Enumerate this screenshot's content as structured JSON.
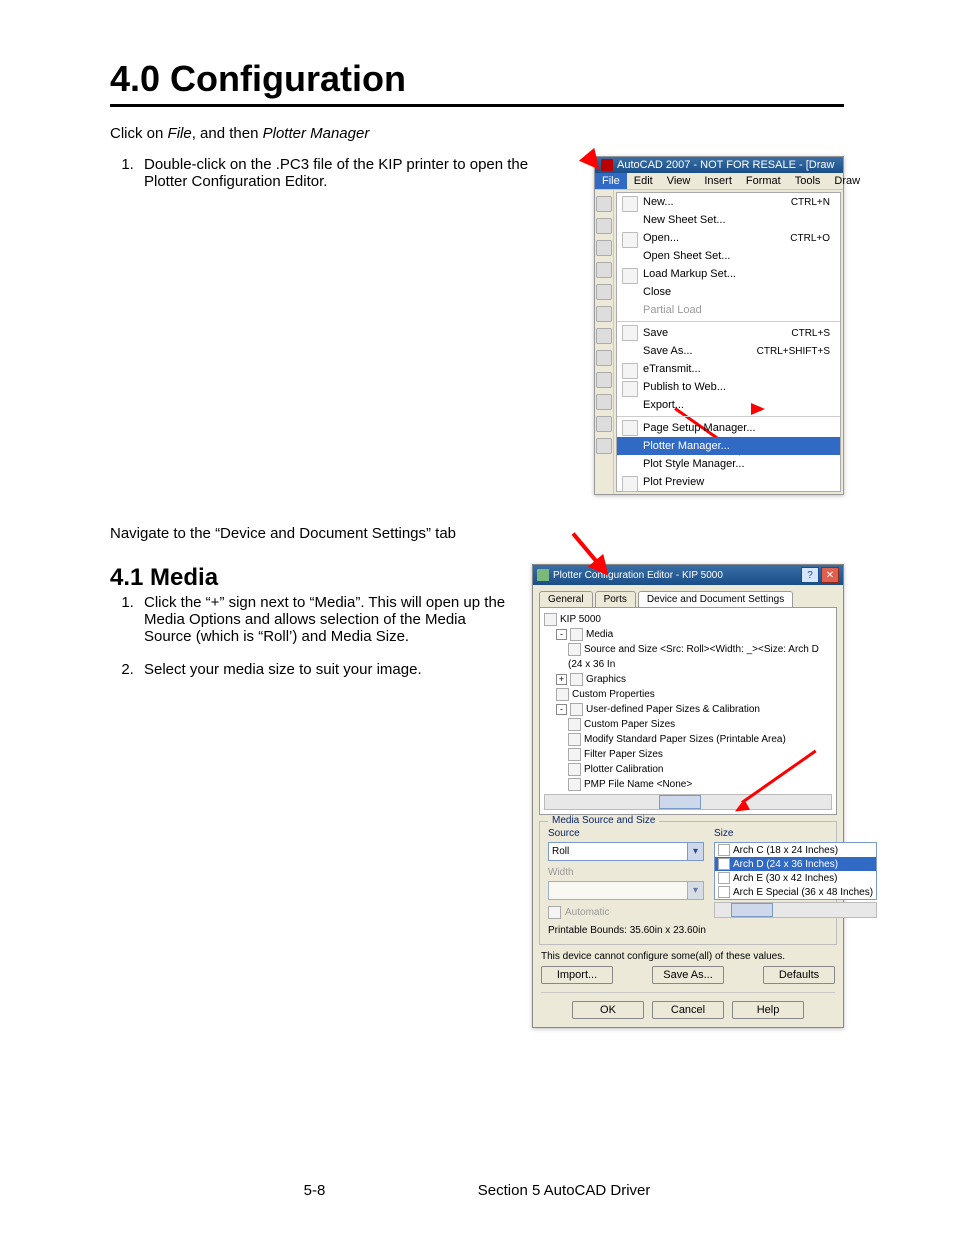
{
  "heading": "4.0 Configuration",
  "intro": {
    "pre": "Click on ",
    "file": "File",
    "mid": ", and then ",
    "pm": "Plotter Manager"
  },
  "step1": "Double-click on the .PC3 file of the KIP printer to open the Plotter Configuration Editor.",
  "nav_line": "Navigate to the “Device and Document  Settings” tab",
  "sub_heading": "4.1 Media",
  "media_step1": "Click the “+” sign next to “Media”. This will open up the Media Options and allows selection of the Media Source (which is “Roll’) and Media Size.",
  "media_step2": "Select your media size to suit your image.",
  "shot1": {
    "title": "AutoCAD 2007 - NOT FOR RESALE - [Draw",
    "menubar": [
      "File",
      "Edit",
      "View",
      "Insert",
      "Format",
      "Tools",
      "Draw"
    ],
    "items": [
      {
        "label": "New...",
        "sc": "CTRL+N",
        "icon": true
      },
      {
        "label": "New Sheet Set..."
      },
      {
        "label": "Open...",
        "sc": "CTRL+O",
        "icon": true
      },
      {
        "label": "Open Sheet Set..."
      },
      {
        "label": "Load Markup Set...",
        "icon": true
      },
      {
        "label": "Close"
      },
      {
        "label": "Partial Load",
        "disabled": true
      },
      {
        "label": "Save",
        "sc": "CTRL+S",
        "sep": true,
        "icon": true
      },
      {
        "label": "Save As...",
        "sc": "CTRL+SHIFT+S"
      },
      {
        "label": "eTransmit...",
        "icon": true
      },
      {
        "label": "Publish to Web...",
        "icon": true
      },
      {
        "label": "Export..."
      },
      {
        "label": "Page Setup Manager...",
        "sep": true,
        "icon": true
      },
      {
        "label": "Plotter Manager...",
        "selected": true
      },
      {
        "label": "Plot Style Manager..."
      },
      {
        "label": "Plot Preview",
        "icon": true
      }
    ]
  },
  "shot2": {
    "title": "Plotter Configuration Editor - KIP 5000",
    "tabs": [
      "General",
      "Ports",
      "Device and Document Settings"
    ],
    "active_tab": 2,
    "tree": [
      {
        "l": 0,
        "t": "KIP 5000"
      },
      {
        "l": 1,
        "pm": "-",
        "t": "Media"
      },
      {
        "l": 2,
        "t": "Source and Size <Src:  Roll><Width: _><Size: Arch D (24 x 36 In"
      },
      {
        "l": 1,
        "pm": "+",
        "t": "Graphics"
      },
      {
        "l": 1,
        "t": "Custom Properties"
      },
      {
        "l": 1,
        "pm": "-",
        "t": "User-defined Paper Sizes & Calibration"
      },
      {
        "l": 2,
        "t": "Custom Paper Sizes"
      },
      {
        "l": 2,
        "t": "Modify Standard Paper Sizes (Printable Area)"
      },
      {
        "l": 2,
        "t": "Filter Paper Sizes"
      },
      {
        "l": 2,
        "t": "Plotter Calibration"
      },
      {
        "l": 2,
        "t": "PMP File Name <None>"
      }
    ],
    "group": "Media Source and Size",
    "source_label": "Source",
    "source_value": "Roll",
    "width_label": "Width",
    "width_value": "",
    "auto": "Automatic",
    "size_label": "Size",
    "sizes": [
      {
        "t": "Arch C (18 x 24 Inches)"
      },
      {
        "t": "Arch D (24 x 36 Inches)",
        "sel": true
      },
      {
        "t": "Arch E (30 x 42 Inches)"
      },
      {
        "t": "Arch E Special (36 x 48 Inches)"
      }
    ],
    "bounds": "Printable Bounds: 35.60in x 23.60in",
    "note": "This device cannot configure some(all) of these values.",
    "import": "Import...",
    "saveas": "Save As...",
    "defaults": "Defaults",
    "ok": "OK",
    "cancel": "Cancel",
    "help": "Help"
  },
  "footer": {
    "page": "5-8",
    "section": "Section 5    AutoCAD Driver"
  }
}
